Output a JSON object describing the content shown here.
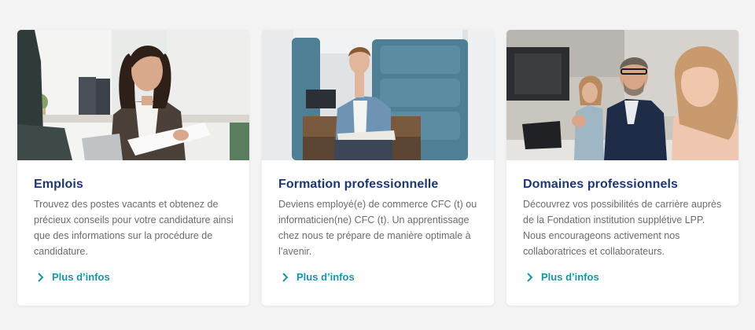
{
  "cards": [
    {
      "image": "woman-office-smiling-photo",
      "title": "Emplois",
      "description": "Trouvez des postes vacants et obtenez de précieux conseils pour votre candidature ainsi que des informations sur la procédure de candidature.",
      "link_label": "Plus d’infos"
    },
    {
      "image": "apprentice-young-man-photo",
      "title": "Formation professionnelle",
      "description": "Deviens employé(e) de commerce CFC (t) ou informaticien(ne) CFC (t). Un apprentissage chez nous te prépare de manière optimale à l’avenir.",
      "link_label": "Plus d’infos"
    },
    {
      "image": "team-meeting-photo",
      "title": "Domaines professionnels",
      "description": "Découvrez vos possibilités de carrière auprès de la Fondation institution supplétive LPP. Nous encourageons activement nos collaboratrices et collaborateurs.",
      "link_label": "Plus d’infos"
    }
  ],
  "colors": {
    "background": "#f3f3f3",
    "title": "#1d3773",
    "text": "#6c6c6c",
    "link": "#1b93a8"
  }
}
